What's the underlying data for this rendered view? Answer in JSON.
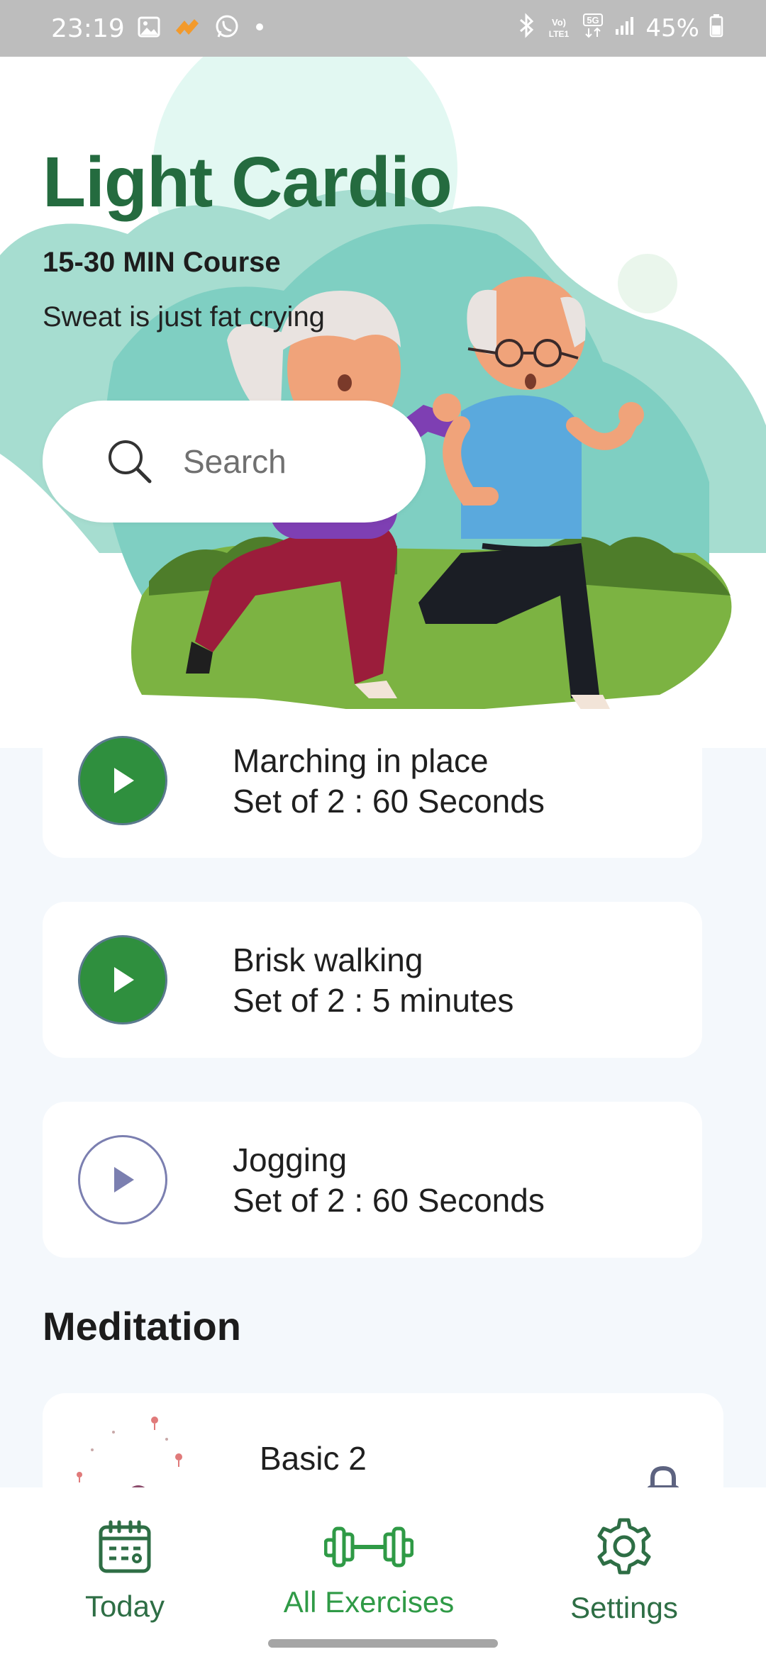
{
  "status_bar": {
    "time": "23:19",
    "battery": "45%",
    "volte_label": "Vo)\nLTE1",
    "network_label": "5G",
    "icons": [
      "image-icon",
      "app-notification-icon",
      "whatsapp-icon",
      "dot-icon",
      "bluetooth-icon",
      "volte-icon",
      "5g-icon",
      "signal-icon",
      "battery-icon"
    ]
  },
  "hero": {
    "title": "Light Cardio",
    "subtitle": "15-30 MIN Course",
    "tagline": "Sweat is just fat crying"
  },
  "search": {
    "placeholder": "Search",
    "value": ""
  },
  "exercises": [
    {
      "name": "Marching in place",
      "detail": "Set of 2 : 60 Seconds",
      "state": "filled"
    },
    {
      "name": "Brisk walking",
      "detail": "Set of 2 : 5 minutes",
      "state": "filled"
    },
    {
      "name": "Jogging",
      "detail": "Set of 2 : 60 Seconds",
      "state": "outline"
    }
  ],
  "meditation": {
    "section_title": "Meditation",
    "items": [
      {
        "title": "Basic 2",
        "locked": true
      }
    ]
  },
  "nav": {
    "items": [
      {
        "label": "Today",
        "icon": "calendar-icon",
        "active": false
      },
      {
        "label": "All Exercises",
        "icon": "dumbbell-icon",
        "active": true
      },
      {
        "label": "Settings",
        "icon": "gear-icon",
        "active": false
      }
    ]
  },
  "colors": {
    "accent_green": "#2f8f3e",
    "title_green": "#246b3f",
    "nav_green": "#2e6e45",
    "background": "#f4f8fc"
  }
}
